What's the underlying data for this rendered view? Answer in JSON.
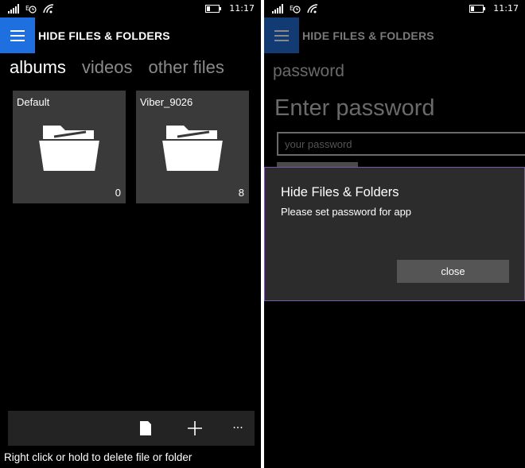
{
  "status_bar": {
    "time": "11:17",
    "battery_fraction": 0.3
  },
  "app": {
    "title": "HIDE FILES & FOLDERS"
  },
  "pivots": [
    "albums",
    "videos",
    "other files"
  ],
  "albums": [
    {
      "name": "Default",
      "count": "0"
    },
    {
      "name": "Viber_9026",
      "count": "8"
    }
  ],
  "command_bar": {
    "icons": [
      "file-icon",
      "plus-icon",
      "more-icon"
    ],
    "more_glyph": "···"
  },
  "hint": "Right click or hold to delete file or folder",
  "password_page": {
    "label": "password",
    "heading": "Enter password",
    "placeholder": "your password"
  },
  "dialog": {
    "title": "Hide Files & Folders",
    "message": "Please set password for app",
    "close_label": "close"
  },
  "colors": {
    "accent": "#1e6fe0",
    "tile": "#3a3a3a",
    "dialog_border": "#7b58a9"
  }
}
